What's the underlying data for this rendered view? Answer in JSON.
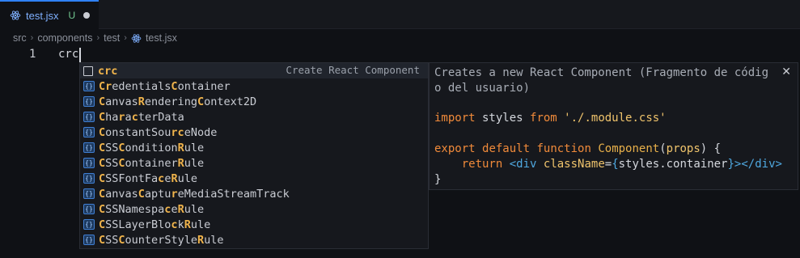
{
  "tab": {
    "name": "test.jsx",
    "status": "U",
    "icon": "react-icon"
  },
  "breadcrumb": [
    "src",
    "components",
    "test",
    "test.jsx"
  ],
  "editor": {
    "line_number": "1",
    "code": "crc"
  },
  "suggestions": [
    {
      "parts": [
        {
          "t": "crc",
          "h": false
        }
      ],
      "kind": "snippet",
      "detail": "Create React Component",
      "selected": true
    },
    {
      "parts": [
        {
          "t": "Cr",
          "h": true
        },
        {
          "t": "edentials",
          "h": false
        },
        {
          "t": "C",
          "h": true
        },
        {
          "t": "ontainer",
          "h": false
        }
      ],
      "kind": "class"
    },
    {
      "parts": [
        {
          "t": "C",
          "h": true
        },
        {
          "t": "anvas",
          "h": false
        },
        {
          "t": "R",
          "h": true
        },
        {
          "t": "endering",
          "h": false
        },
        {
          "t": "C",
          "h": true
        },
        {
          "t": "ontext2D",
          "h": false
        }
      ],
      "kind": "class"
    },
    {
      "parts": [
        {
          "t": "C",
          "h": true
        },
        {
          "t": "ha",
          "h": false
        },
        {
          "t": "r",
          "h": true
        },
        {
          "t": "a",
          "h": false
        },
        {
          "t": "c",
          "h": true
        },
        {
          "t": "terData",
          "h": false
        }
      ],
      "kind": "class"
    },
    {
      "parts": [
        {
          "t": "C",
          "h": true
        },
        {
          "t": "onstantSou",
          "h": false
        },
        {
          "t": "rc",
          "h": true
        },
        {
          "t": "eNode",
          "h": false
        }
      ],
      "kind": "class"
    },
    {
      "parts": [
        {
          "t": "C",
          "h": true
        },
        {
          "t": "SS",
          "h": false
        },
        {
          "t": "C",
          "h": true
        },
        {
          "t": "ondition",
          "h": false
        },
        {
          "t": "R",
          "h": true
        },
        {
          "t": "ule",
          "h": false
        }
      ],
      "kind": "class"
    },
    {
      "parts": [
        {
          "t": "C",
          "h": true
        },
        {
          "t": "SS",
          "h": false
        },
        {
          "t": "C",
          "h": true
        },
        {
          "t": "ontainer",
          "h": false
        },
        {
          "t": "R",
          "h": true
        },
        {
          "t": "ule",
          "h": false
        }
      ],
      "kind": "class"
    },
    {
      "parts": [
        {
          "t": "C",
          "h": true
        },
        {
          "t": "SSFontFa",
          "h": false
        },
        {
          "t": "c",
          "h": true
        },
        {
          "t": "e",
          "h": false
        },
        {
          "t": "R",
          "h": true
        },
        {
          "t": "ule",
          "h": false
        }
      ],
      "kind": "class"
    },
    {
      "parts": [
        {
          "t": "C",
          "h": true
        },
        {
          "t": "anvas",
          "h": false
        },
        {
          "t": "C",
          "h": true
        },
        {
          "t": "aptu",
          "h": false
        },
        {
          "t": "r",
          "h": true
        },
        {
          "t": "eMediaStreamTrack",
          "h": false
        }
      ],
      "kind": "class"
    },
    {
      "parts": [
        {
          "t": "C",
          "h": true
        },
        {
          "t": "SSNamespa",
          "h": false
        },
        {
          "t": "c",
          "h": true
        },
        {
          "t": "e",
          "h": false
        },
        {
          "t": "R",
          "h": true
        },
        {
          "t": "ule",
          "h": false
        }
      ],
      "kind": "class"
    },
    {
      "parts": [
        {
          "t": "C",
          "h": true
        },
        {
          "t": "SSLayerBlo",
          "h": false
        },
        {
          "t": "c",
          "h": true
        },
        {
          "t": "k",
          "h": false
        },
        {
          "t": "R",
          "h": true
        },
        {
          "t": "ule",
          "h": false
        }
      ],
      "kind": "class"
    },
    {
      "parts": [
        {
          "t": "C",
          "h": true
        },
        {
          "t": "SS",
          "h": false
        },
        {
          "t": "C",
          "h": true
        },
        {
          "t": "ounterStyle",
          "h": false
        },
        {
          "t": "R",
          "h": true
        },
        {
          "t": "ule",
          "h": false
        }
      ],
      "kind": "class"
    }
  ],
  "details": {
    "description": "Creates a new React Component (Fragmento de código del usuario)",
    "description_lines": [
      "Creates a new React Component (Fragmento de códig",
      "o del usuario)"
    ],
    "close_glyph": "✕",
    "code_lines": [
      [
        {
          "t": "import",
          "c": "kw"
        },
        {
          "t": " styles ",
          "c": ""
        },
        {
          "t": "from",
          "c": "kw"
        },
        {
          "t": " ",
          "c": ""
        },
        {
          "t": "'./.module.css'",
          "c": "str"
        }
      ],
      [],
      [
        {
          "t": "export",
          "c": "kw"
        },
        {
          "t": " ",
          "c": ""
        },
        {
          "t": "default",
          "c": "kw"
        },
        {
          "t": " ",
          "c": ""
        },
        {
          "t": "function",
          "c": "kw"
        },
        {
          "t": " ",
          "c": ""
        },
        {
          "t": "Component",
          "c": "fn"
        },
        {
          "t": "(",
          "c": ""
        },
        {
          "t": "props",
          "c": "str"
        },
        {
          "t": ") {",
          "c": ""
        }
      ],
      [
        {
          "t": "    ",
          "c": ""
        },
        {
          "t": "return",
          "c": "kw"
        },
        {
          "t": " ",
          "c": ""
        },
        {
          "t": "<div",
          "c": "tag"
        },
        {
          "t": " ",
          "c": ""
        },
        {
          "t": "className",
          "c": "attr"
        },
        {
          "t": "=",
          "c": ""
        },
        {
          "t": "{",
          "c": "punct"
        },
        {
          "t": "styles.container",
          "c": ""
        },
        {
          "t": "}",
          "c": "punct"
        },
        {
          "t": "></div>",
          "c": "tag"
        }
      ],
      [
        {
          "t": "}",
          "c": ""
        }
      ]
    ]
  },
  "colors": {
    "accent": "#2f81f7",
    "highlight": "#f0b44c",
    "keyword": "#f08a3a",
    "untracked": "#73c991"
  }
}
